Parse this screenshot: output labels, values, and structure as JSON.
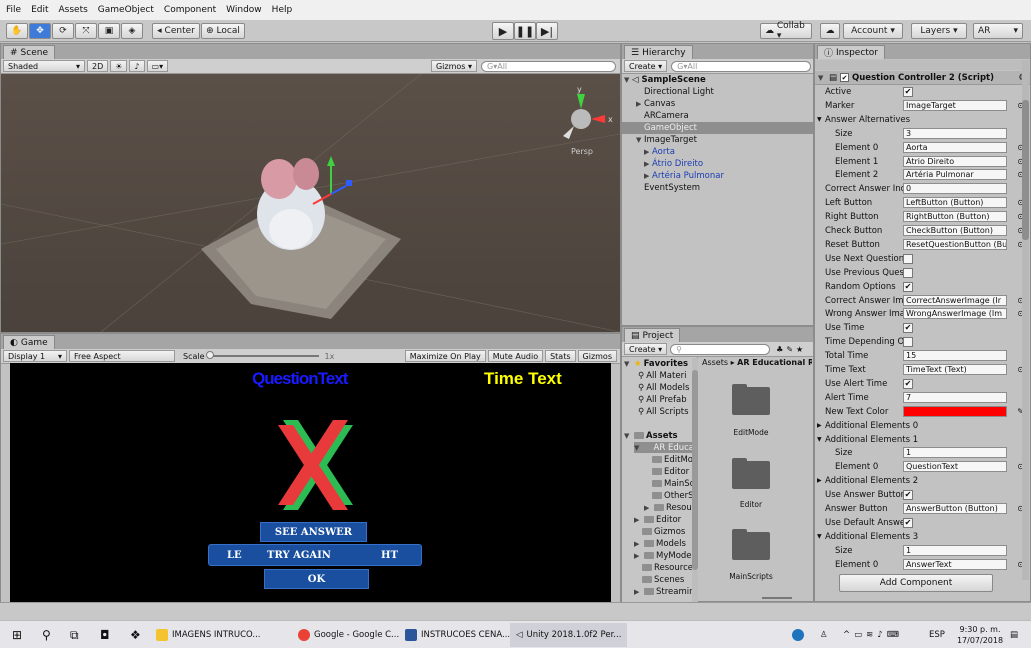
{
  "menu": [
    "File",
    "Edit",
    "Assets",
    "GameObject",
    "Component",
    "Window",
    "Help"
  ],
  "toolbar": {
    "center": "Center",
    "local": "Local",
    "collab": "Collab ▾",
    "account": "Account",
    "layers": "Layers",
    "layout": "AR"
  },
  "scene": {
    "tab": "Scene",
    "shading": "Shaded",
    "mode2d": "2D",
    "gizmos": "Gizmos",
    "search_placeholder": "G▾All",
    "persp": "Persp",
    "axis_y": "y",
    "axis_x": "x"
  },
  "game": {
    "tab": "Game",
    "display": "Display 1",
    "aspect": "Free Aspect",
    "scale_label": "Scale",
    "scale_value": "1x",
    "maximize": "Maximize On Play",
    "mute": "Mute Audio",
    "stats": "Stats",
    "gizmos": "Gizmos",
    "question_text": "QuestionText",
    "time_text": "Time Text",
    "btn_see_answer": "SEE ANSWER",
    "btn_left": "LE",
    "btn_try_again": "TRY AGAIN",
    "btn_right": "HT",
    "btn_ok": "OK"
  },
  "hierarchy": {
    "tab": "Hierarchy",
    "create": "Create",
    "search": "G▾All",
    "scene_name": "SampleScene",
    "items": [
      "Directional Light",
      "Canvas",
      "ARCamera",
      "GameObject",
      "ImageTarget",
      "Aorta",
      "Átrio Direito",
      "Artéria Pulmonar",
      "EventSystem"
    ]
  },
  "project": {
    "tab": "Project",
    "create": "Create",
    "breadcrumb_root": "Assets",
    "breadcrumb_child": "AR Educational R",
    "favorites": "Favorites",
    "fav_items": [
      "All Materi",
      "All Models",
      "All Prefab",
      "All Scripts"
    ],
    "assets": "Assets",
    "tree": [
      "AR Educa",
      "EditMod",
      "Editor",
      "MainSc",
      "OtherS",
      "Resour",
      "Editor",
      "Gizmos",
      "Models",
      "MyModels",
      "Resource",
      "Scenes",
      "Streamin"
    ],
    "folders": [
      "EditMode",
      "Editor",
      "MainScripts"
    ]
  },
  "inspector": {
    "tab": "Inspector",
    "component": "Question Controller 2 (Script)",
    "rows": [
      {
        "label": "Active",
        "type": "check",
        "value": "✔"
      },
      {
        "label": "Marker",
        "type": "field",
        "value": "ImageTarget"
      },
      {
        "label": "Answer Alternatives",
        "type": "fold"
      },
      {
        "label": "Size",
        "type": "field",
        "value": "3"
      },
      {
        "label": "Element 0",
        "type": "field",
        "value": "Aorta"
      },
      {
        "label": "Element 1",
        "type": "field",
        "value": "Átrio Direito"
      },
      {
        "label": "Element 2",
        "type": "field",
        "value": "Artéria Pulmonar"
      },
      {
        "label": "Correct Answer Inde",
        "type": "field",
        "value": "0"
      },
      {
        "label": "Left Button",
        "type": "field",
        "value": "LeftButton (Button)"
      },
      {
        "label": "Right Button",
        "type": "field",
        "value": "RightButton (Button)"
      },
      {
        "label": "Check Button",
        "type": "field",
        "value": "CheckButton (Button)"
      },
      {
        "label": "Reset Button",
        "type": "field",
        "value": "ResetQuestionButton (Bu"
      },
      {
        "label": "Use Next Question B",
        "type": "check",
        "value": ""
      },
      {
        "label": "Use Previous Questi",
        "type": "check",
        "value": ""
      },
      {
        "label": "Random Options",
        "type": "check",
        "value": "✔"
      },
      {
        "label": "Correct Answer Ima",
        "type": "field",
        "value": "CorrectAnswerImage (Ir"
      },
      {
        "label": "Wrong Answer Imag",
        "type": "field",
        "value": "WrongAnswerImage (Im"
      },
      {
        "label": "Use Time",
        "type": "check",
        "value": "✔"
      },
      {
        "label": "Time Depending Of I",
        "type": "check",
        "value": ""
      },
      {
        "label": "Total Time",
        "type": "field",
        "value": "15"
      },
      {
        "label": "Time Text",
        "type": "field",
        "value": "TimeText (Text)"
      },
      {
        "label": "Use Alert Time",
        "type": "check",
        "value": "✔"
      },
      {
        "label": "Alert Time",
        "type": "field",
        "value": "7"
      },
      {
        "label": "New Text Color",
        "type": "color",
        "value": ""
      },
      {
        "label": "Additional Elements 0",
        "type": "fold"
      },
      {
        "label": "Additional Elements 1",
        "type": "fold"
      },
      {
        "label": "Size",
        "type": "field",
        "value": "1"
      },
      {
        "label": "Element 0",
        "type": "field",
        "value": "QuestionText"
      },
      {
        "label": "Additional Elements 2",
        "type": "fold"
      },
      {
        "label": "Use Answer Button",
        "type": "check",
        "value": "✔"
      },
      {
        "label": "Answer Button",
        "type": "field",
        "value": "AnswerButton (Button)"
      },
      {
        "label": "Use Default Answer",
        "type": "check",
        "value": "✔"
      },
      {
        "label": "Additional Elements 3",
        "type": "fold"
      },
      {
        "label": "Size",
        "type": "field",
        "value": "1"
      },
      {
        "label": "Element 0",
        "type": "field",
        "value": "AnswerText"
      }
    ],
    "add_component": "Add Component"
  },
  "taskbar": {
    "items": [
      "IMAGENS INTRUCO...",
      "Google - Google C...",
      "INSTRUCOES CENA...",
      "Unity 2018.1.0f2 Per..."
    ],
    "lang": "ESP",
    "time": "9:30 p. m.",
    "date": "17/07/2018"
  },
  "colors": {
    "new_text_color": "#ff0000",
    "question_text": "#1a1aff",
    "time_text": "#ffff00",
    "button_blue": "#1a4fa0"
  }
}
